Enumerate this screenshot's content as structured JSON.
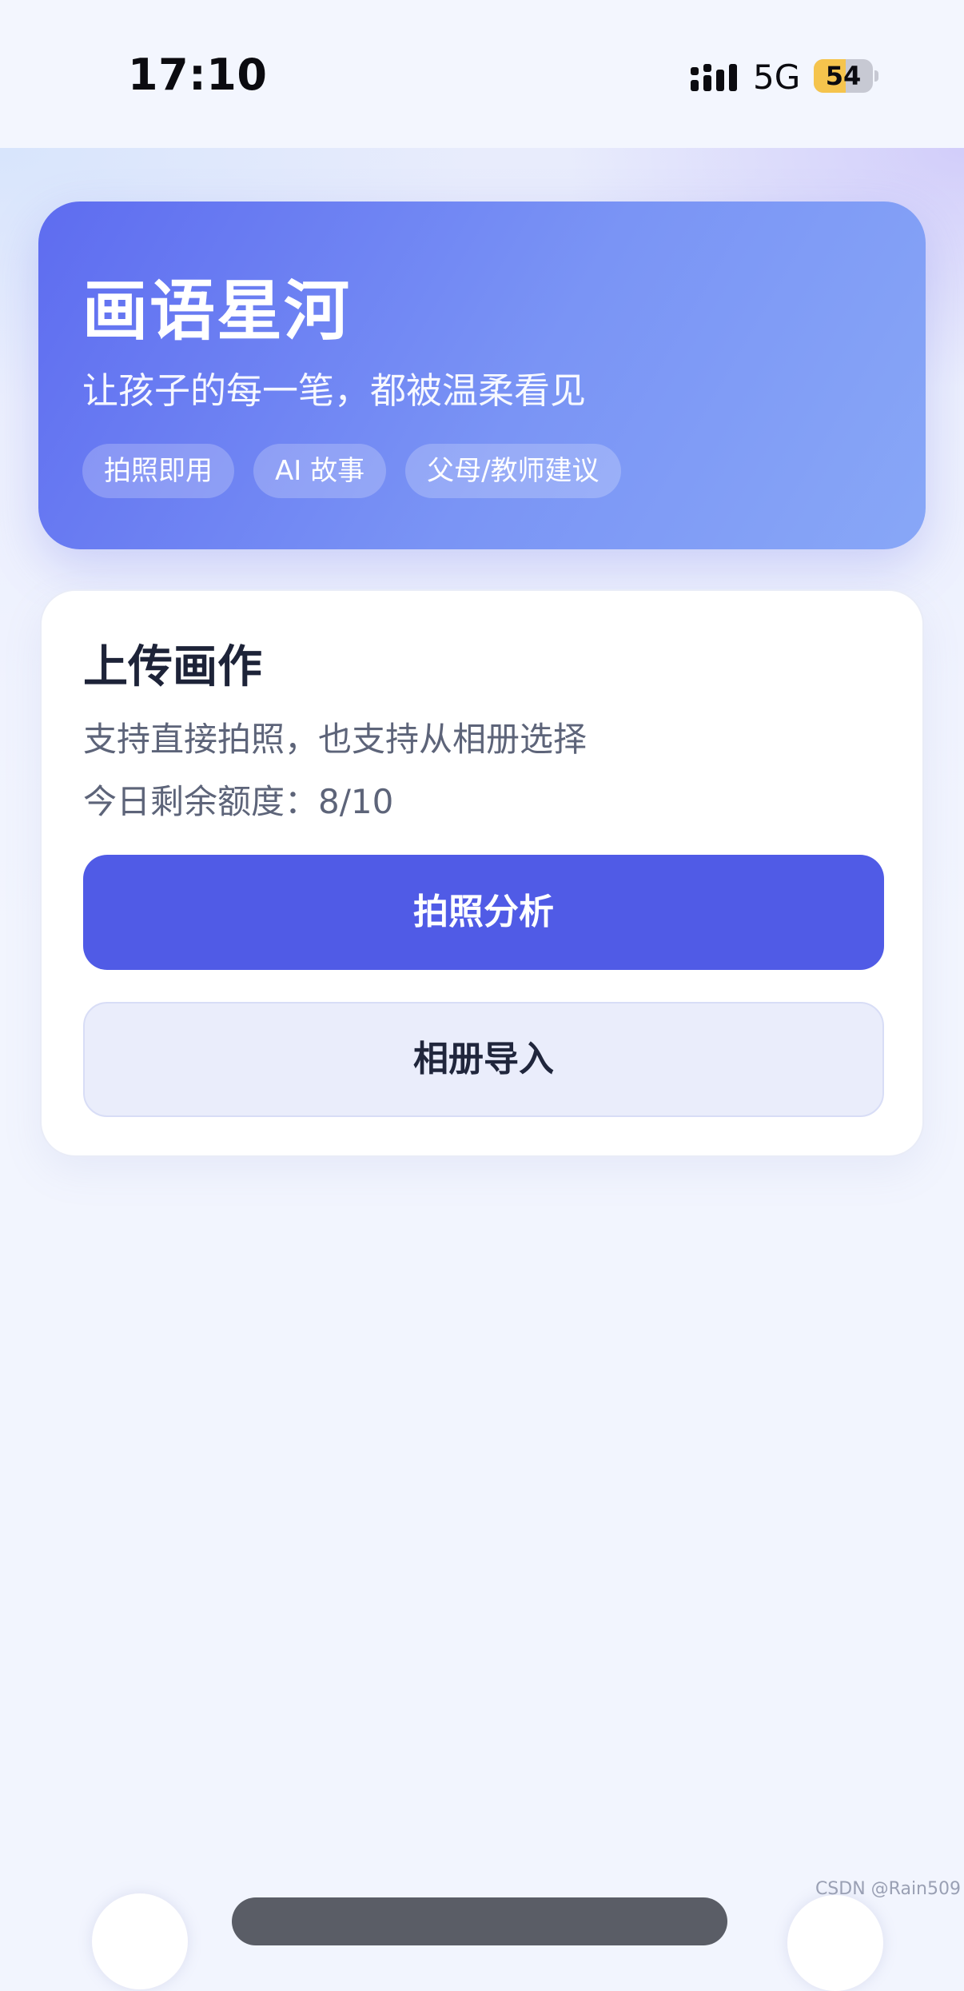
{
  "status_bar": {
    "time": "17:10",
    "network": "5G",
    "battery": "54",
    "battery_fraction": 0.54,
    "icons": {
      "signal": "signal-bars-icon",
      "battery": "battery-icon"
    }
  },
  "hero": {
    "title": "画语星河",
    "subtitle": "让孩子的每一笔，都被温柔看见",
    "tags": [
      "拍照即用",
      "AI 故事",
      "父母/教师建议"
    ]
  },
  "upload_card": {
    "title": "上传画作",
    "description": "支持直接拍照，也支持从相册选择",
    "quota_label": "今日剩余额度：8/10",
    "primary_button": "拍照分析",
    "secondary_button": "相册导入"
  },
  "watermark": "CSDN @Rain509",
  "colors": {
    "primary": "#505be6",
    "hero_start": "#5e6cf0",
    "hero_end": "#88a7f7",
    "background": "#f2f5fe",
    "battery_fill": "#f5c44d"
  }
}
